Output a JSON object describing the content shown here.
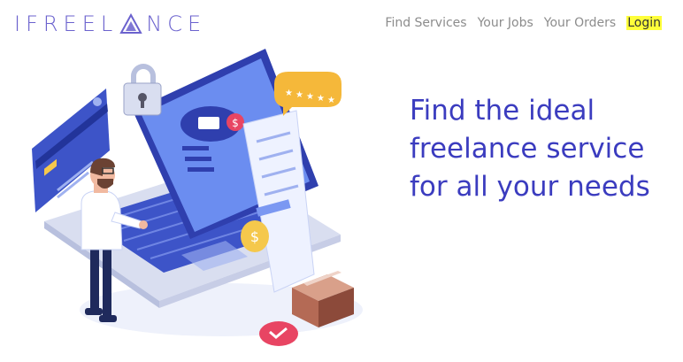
{
  "brand": {
    "logo_text": "IFREELANCE",
    "logo_prefix": "IFREEL",
    "logo_suffix": "NCE",
    "color": "#6b62ce"
  },
  "nav": {
    "items": [
      {
        "label": "Find Services"
      },
      {
        "label": "Your Jobs"
      },
      {
        "label": "Your Orders"
      },
      {
        "label": "Login"
      }
    ],
    "login_highlight": "#ffff3a"
  },
  "hero": {
    "headline": "Find the ideal freelance service for all your needs",
    "headline_color": "#3b3cbf",
    "illustration_badge": "$"
  }
}
